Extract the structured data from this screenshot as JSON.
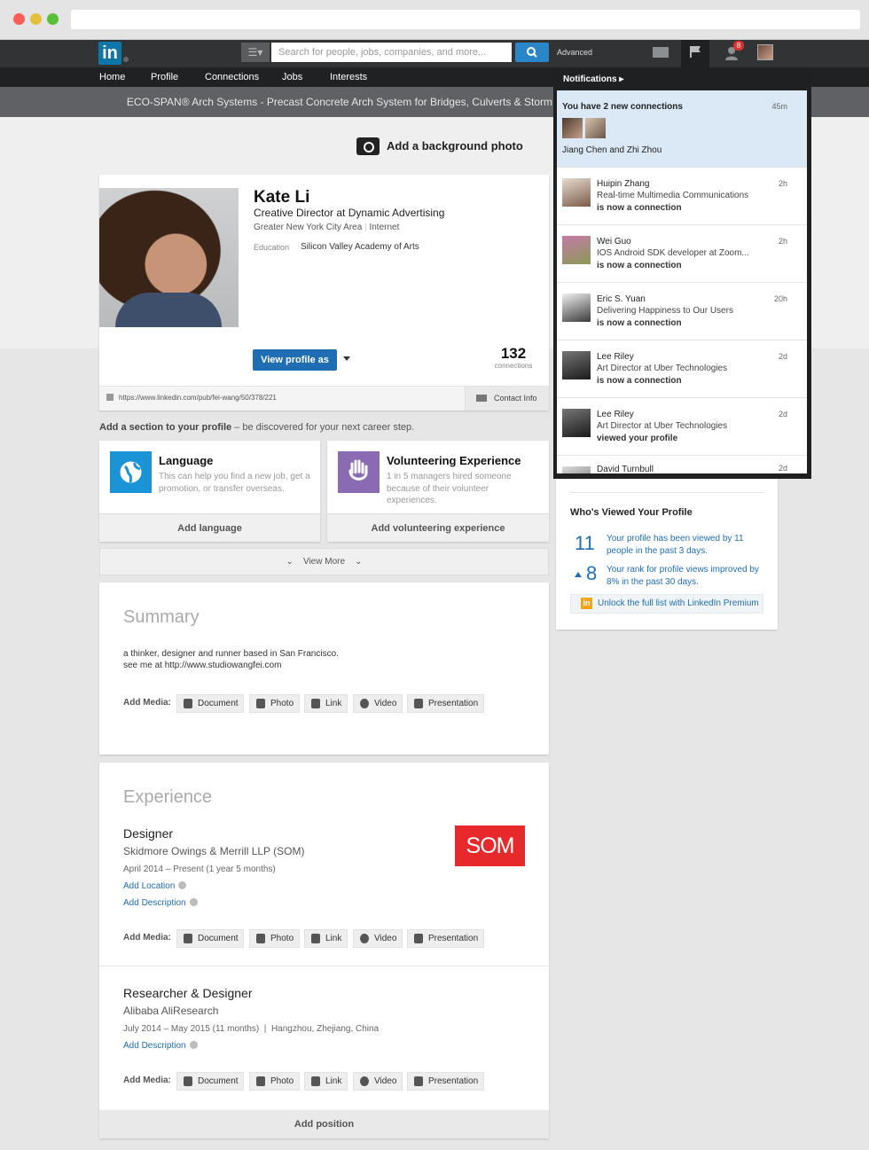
{
  "colors": {
    "linkedin_blue": "#1f6eb4",
    "nav_dark": "#313335",
    "badge_red": "#e0332e",
    "som_red": "#e8292b",
    "language_blue": "#1b93d7",
    "volunteer_purple": "#8a6bb3",
    "premium_orange": "#f2a416"
  },
  "topnav": {
    "logo_text": "in",
    "search_placeholder": "Search for people, jobs, companies, and more...",
    "advanced_label": "Advanced",
    "notification_badge": "8",
    "icons": [
      "linkedin-logo",
      "search-icon",
      "envelope-icon",
      "flag-icon",
      "add-connection-icon",
      "avatar"
    ]
  },
  "secnav": {
    "items": [
      "Home",
      "Profile",
      "Connections",
      "Jobs",
      "Interests"
    ]
  },
  "ad": {
    "text": "ECO-SPAN® Arch Systems - Precast Concrete Arch System for Bridges, Culverts & Storm"
  },
  "profile": {
    "add_background": "Add a background photo",
    "name": "Kate Li",
    "headline": "Creative Director at Dynamic Advertising",
    "location": "Greater New York City Area",
    "industry": "Internet",
    "education_label": "Education",
    "education_value": "Silicon Valley Academy of Arts",
    "view_as_label": "View profile as",
    "connections_count": "132",
    "connections_label": "connections",
    "public_url": "https://www.linkedin.com/pub/fei-wang/50/378/221",
    "contact_info_label": "Contact Info"
  },
  "add_section": {
    "lead": "Add a section to your profile",
    "tail": " – be discovered for your next career step.",
    "cards": [
      {
        "title": "Language",
        "desc": "This can help you find a new job, get a promotion, or transfer overseas.",
        "button": "Add language",
        "icon": "globe-icon"
      },
      {
        "title": "Volunteering Experience",
        "desc": "1 in 5 managers hired someone because of their volunteer experiences.",
        "button": "Add volunteering experience",
        "icon": "hand-heart-icon"
      }
    ],
    "view_more": "View More"
  },
  "summary": {
    "heading": "Summary",
    "line1": "a thinker, designer and runner based in San Francisco.",
    "line2": "see me at http://www.studiowangfei.com"
  },
  "media": {
    "label": "Add Media:",
    "buttons": [
      "Document",
      "Photo",
      "Link",
      "Video",
      "Presentation"
    ]
  },
  "experience": {
    "heading": "Experience",
    "positions": [
      {
        "title": "Designer",
        "company": "Skidmore Owings & Merrill LLP (SOM)",
        "dates": "April 2014 – Present (1 year 5 months)",
        "add_location": "Add Location",
        "add_description": "Add Description",
        "logo_text": "SOM"
      },
      {
        "title": "Researcher & Designer",
        "company": "Alibaba AliResearch",
        "dates": "July 2014 – May 2015 (11 months)",
        "location": "Hangzhou, Zhejiang, China",
        "add_description": "Add Description"
      }
    ],
    "add_position": "Add position"
  },
  "sidebar": {
    "title": "Who's Viewed Your Profile",
    "views_count": "11",
    "views_text": "Your profile has been viewed by 11 people in the past 3 days.",
    "rank_count": "8",
    "rank_text": "Your rank for profile views improved by 8% in the past 30 days.",
    "premium_icon": "in",
    "premium_text": "Unlock the full list with LinkedIn Premium"
  },
  "notifications": {
    "header": "Notifications",
    "items": [
      {
        "name": "You have 2 new connections",
        "desc": "Jiang Chen and Zhi Zhou",
        "time": "45m"
      },
      {
        "name": "Huipin Zhang",
        "desc": "Real-time Multimedia Communications",
        "action": "is now a connection",
        "time": "2h"
      },
      {
        "name": "Wei Guo",
        "desc": "IOS Android SDK developer at Zoom...",
        "action": "is now a connection",
        "time": "2h"
      },
      {
        "name": "Eric S. Yuan",
        "desc": "Delivering Happiness to Our Users",
        "action": "is now a connection",
        "time": "20h"
      },
      {
        "name": "Lee Riley",
        "desc": "Art Director at Uber Technologies",
        "action": "is now a connection",
        "time": "2d"
      },
      {
        "name": "Lee Riley",
        "desc": "Art Director at Uber Technologies",
        "action": "viewed your profile",
        "time": "2d"
      },
      {
        "name": "David Turnbull",
        "time": "2d"
      }
    ]
  }
}
